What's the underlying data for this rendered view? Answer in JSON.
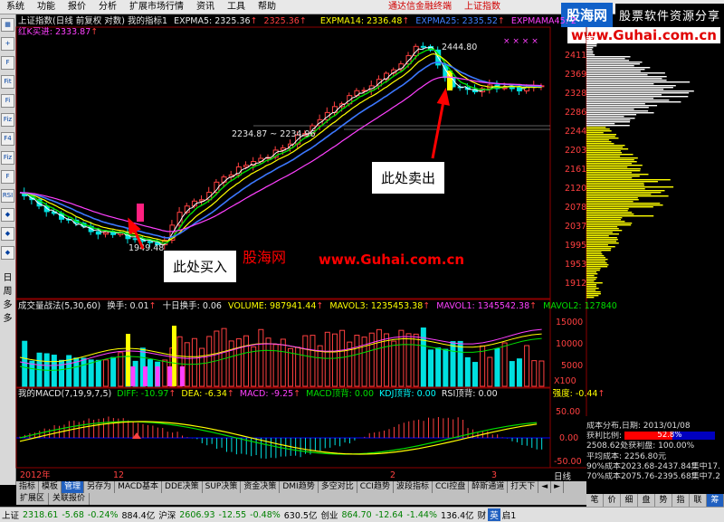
{
  "menu": {
    "items": [
      "系统",
      "功能",
      "报价",
      "分析",
      "扩展市场行情",
      "资讯",
      "工具",
      "帮助"
    ],
    "right_links": [
      "通达信金融终端",
      "上证指数"
    ]
  },
  "logo": {
    "main": "股海网",
    "tag": "股票软件资源分享",
    "url": "www.Guhai.com.cn"
  },
  "left_toolbar": [
    "▦",
    "+",
    "F",
    "Fit",
    "Fi",
    "Fiz",
    "F4",
    "Fiz",
    "F",
    "RSI",
    "◆",
    "◆",
    "◆"
  ],
  "left_vertical_text": [
    "日",
    "周",
    "多",
    "多"
  ],
  "main_header": {
    "title": "上证指数(日线 前复权 对数) 我的指标1",
    "ma5": "EXPMA5: 2325.36",
    "ma5_mark": "↑",
    "ma5b": "2325.36",
    "ma5b_mark": "↑",
    "ma14": "EXPMA14: 2336.48",
    "ma14_mark": "↑",
    "ma25": "EXPMA25: 2335.52",
    "ma25_mark": "↑",
    "ma45": "EXPMAMA45: 2",
    "line2": "红K买进: 2333.87",
    "line2_mark": "↑"
  },
  "price_axis": [
    "2411",
    "2369",
    "2328",
    "2286",
    "2244",
    "2203",
    "2161",
    "2120",
    "2078",
    "2037",
    "1995",
    "1953",
    "1912"
  ],
  "annotations": {
    "high": "2444.80",
    "mid": "2234.87 ~ 2234.96",
    "low": "1949.48",
    "buy": "此处买入",
    "sell": "此处卖出",
    "watermark_text": "股海网",
    "watermark_url": "www.Guhai.com.cn"
  },
  "vol_header": {
    "name": "成交量战法(5,30,60)",
    "turnover": "换手: 0.01",
    "ten_turnover": "十日换手: 0.06",
    "volume": "VOLUME: 987941.44",
    "mavol3": "MAVOL3: 1235453.38",
    "mavol1": "MAVOL1: 1345542.38",
    "mavol2": "MAVOL2: 127840",
    "up_arrow": "↑"
  },
  "vol_axis": [
    "15000",
    "10000",
    "5000"
  ],
  "vol_unit": "X100",
  "macd_header": {
    "name": "我的MACD(7,19,9,7,5)",
    "diff": "DIFF: -10.97",
    "dea": "DEA: -6.34",
    "macd": "MACD: -9.25",
    "macd_top": "MACD顶背: 0.00",
    "kdj_top": "KDJ顶背: 0.00",
    "rsi_top": "RSI顶背: 0.00",
    "strength": "强度: -0.44",
    "arrow": "↑"
  },
  "macd_axis": [
    "50.00",
    "0.00",
    "-50.00"
  ],
  "time_axis": [
    "2012年",
    "12",
    "2",
    "3"
  ],
  "week_label": "日线",
  "right_panel": {
    "date": "成本分布,日期: 2013/01/08",
    "profit_ratio_label": "获利比例:",
    "profit_ratio": "52.8%",
    "profit_ratio_value": 0.528,
    "profit_line": "2508.62处获利盘: 100.00%",
    "avg_cost": "平均成本: 2256.80元",
    "cost90": "90%成本2023.68-2437.84集中17.",
    "cost70": "70%成本2075.76-2395.68集中7.2",
    "tabs": [
      "笔",
      "价",
      "细",
      "盘",
      "势",
      "指",
      "联",
      "筹"
    ]
  },
  "tabs_row1": [
    "指标",
    "模板",
    "管理",
    "另存为",
    "MACD基本",
    "DDE决策",
    "SUP决策",
    "资金决策",
    "DMI趋势",
    "多空对比",
    "CCI趋势",
    "波段指标",
    "CCI控盘",
    "醉斯通道",
    "打天下",
    "◄",
    "►"
  ],
  "tabs_row2": [
    "扩展区",
    "关联报价"
  ],
  "status": {
    "sh_label": "上证",
    "sh_value": "2318.61",
    "sh_change": "-5.68",
    "sh_pct": "-0.24%",
    "sh_amt": "884.4亿",
    "sz_label": "沪深",
    "sz_value": "2606.93",
    "sz_change": "-12.55",
    "sz_pct": "-0.48%",
    "sz_amt": "630.5亿",
    "cy_label": "创业",
    "cy_value": "864.70",
    "cy_change": "-12.64",
    "cy_pct": "-1.44%",
    "cy_amt": "136.4亿",
    "extra": "财",
    "ime": "英",
    "end": "启1"
  },
  "colors": {
    "up": "#ff4040",
    "down": "#00e0e0",
    "ma5": "#ffffff",
    "ma14": "#ffff00",
    "ma25": "#3c78ff",
    "ma45": "#ff40ff",
    "green_line": "#00e000"
  }
}
